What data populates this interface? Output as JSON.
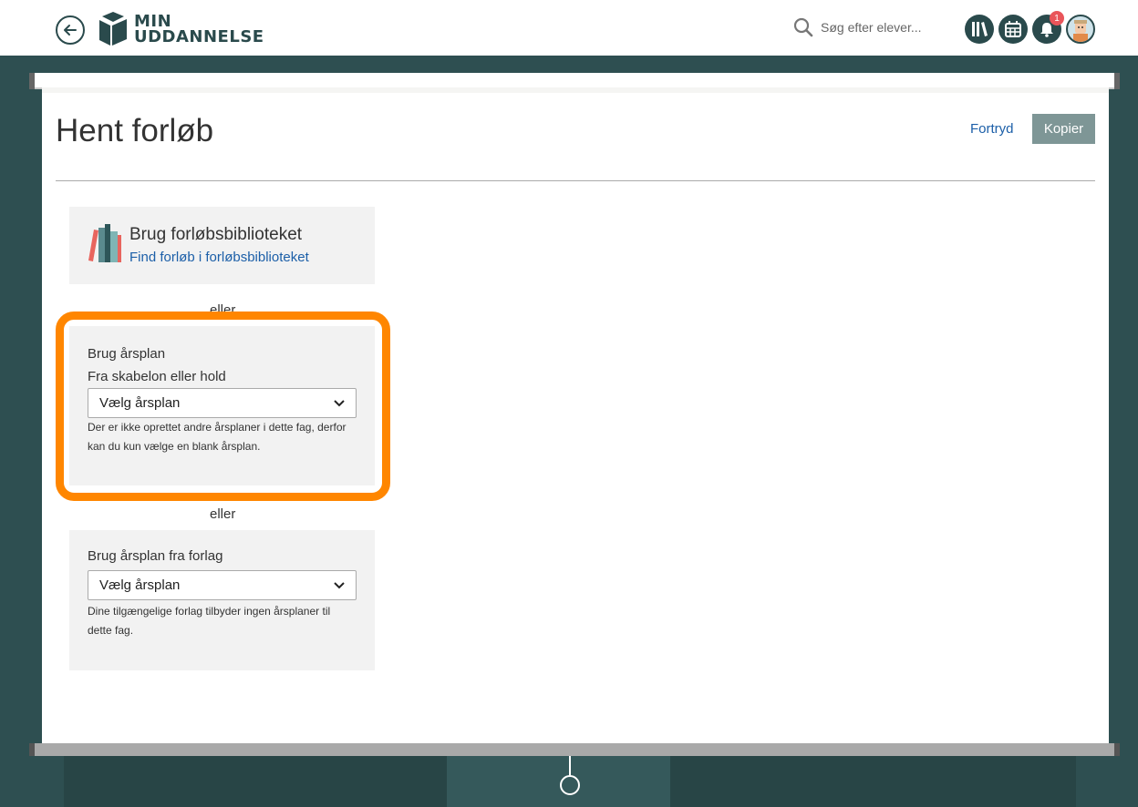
{
  "header": {
    "logo_line1": "MIN",
    "logo_line2": "UDDANNELSE",
    "search_placeholder": "Søg efter elever...",
    "notification_count": "1"
  },
  "page": {
    "title": "Hent forløb",
    "cancel_label": "Fortryd",
    "copy_label": "Kopier"
  },
  "library_card": {
    "title": "Brug forløbsbiblioteket",
    "link": "Find forløb i forløbsbiblioteket"
  },
  "separator": "eller",
  "year_plan_card": {
    "title": "Brug årsplan",
    "subtitle": "Fra skabelon eller hold",
    "select_value": "Vælg årsplan",
    "hint": "Der er ikke oprettet andre årsplaner i dette fag, derfor kan du kun vælge en blank årsplan."
  },
  "publisher_card": {
    "title": "Brug årsplan fra forlag",
    "select_value": "Vælg årsplan",
    "hint": "Dine tilgængelige forlag tilbyder ingen årsplaner til dette fag."
  },
  "colors": {
    "brand": "#2a4a4c",
    "background": "#2e4f51",
    "highlight": "#ff8600",
    "link": "#1c5fa8",
    "primary_button": "#7e9696"
  }
}
